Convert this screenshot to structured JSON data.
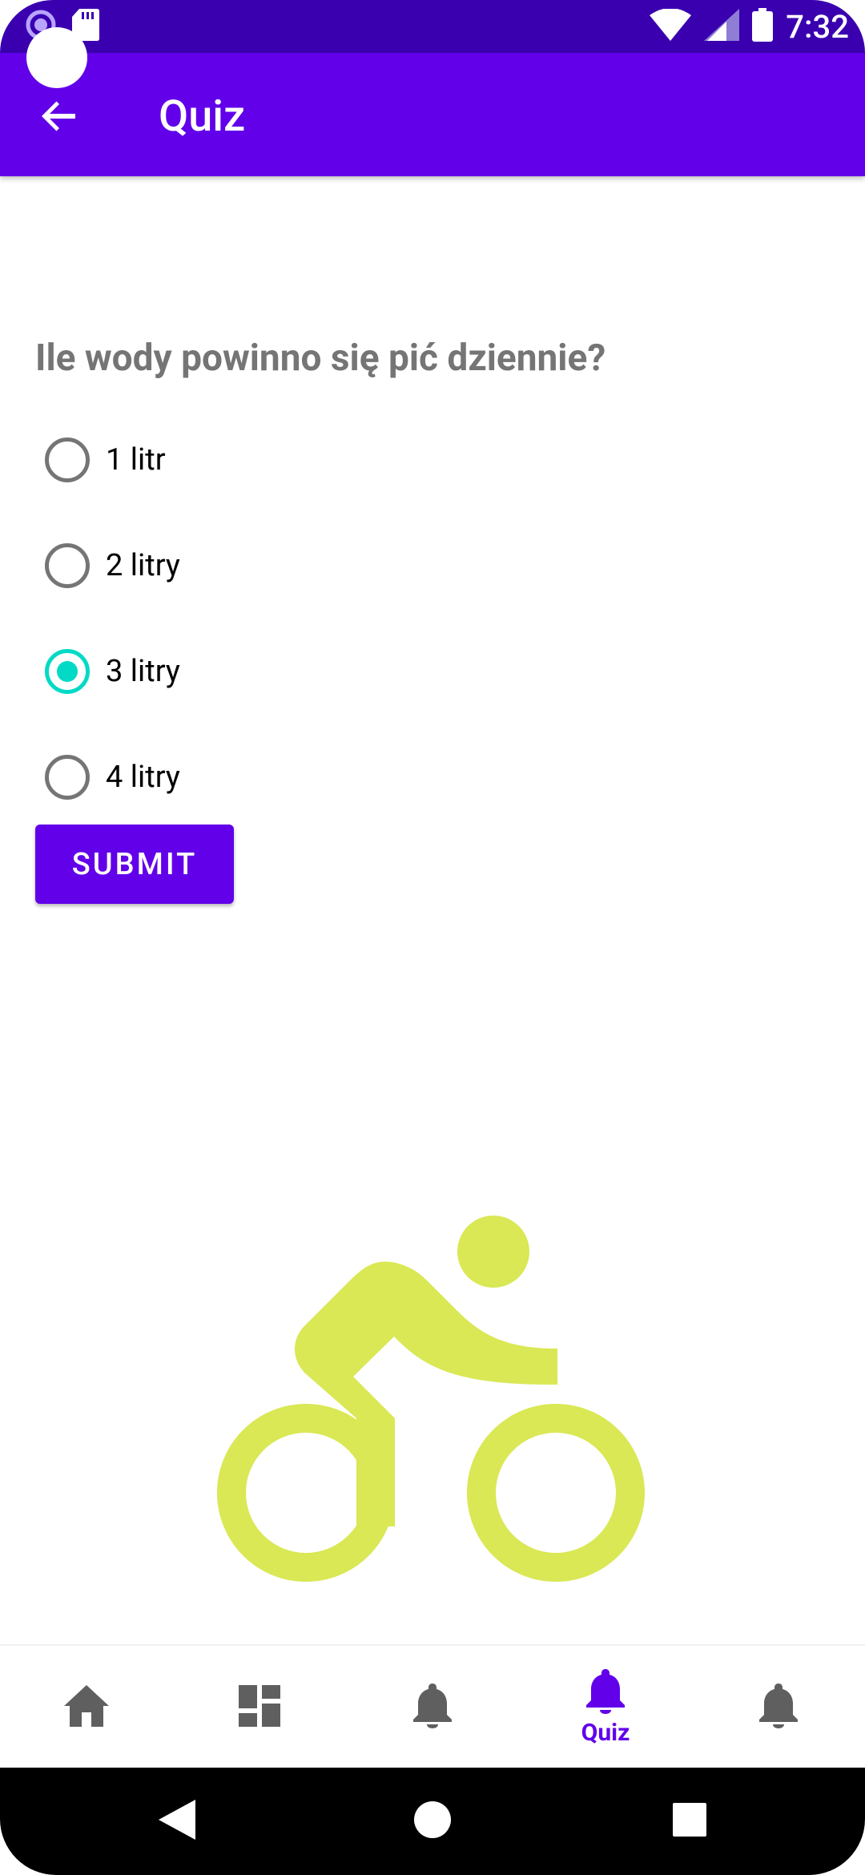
{
  "status_bar": {
    "time": "7:32"
  },
  "app_bar": {
    "title": "Quiz"
  },
  "quiz": {
    "question": "Ile wody powinno się pić dziennie?",
    "options": [
      {
        "label": "1 litr",
        "selected": false
      },
      {
        "label": "2 litry",
        "selected": false
      },
      {
        "label": "3 litry",
        "selected": true
      },
      {
        "label": "4 litry",
        "selected": false
      }
    ],
    "submit_label": "SUBMIT"
  },
  "illustration": {
    "icon": "bike-icon",
    "color": "#d9e854"
  },
  "bottom_nav": {
    "items": [
      {
        "icon": "home-icon",
        "label": ""
      },
      {
        "icon": "dashboard-icon",
        "label": ""
      },
      {
        "icon": "bell-icon",
        "label": ""
      },
      {
        "icon": "bell-icon",
        "label": "Quiz",
        "active": true
      },
      {
        "icon": "bell-icon",
        "label": ""
      }
    ]
  },
  "colors": {
    "primary": "#6200ea",
    "status_bar": "#3a00b0",
    "accent": "#03dac5",
    "inactive_icon": "#5f5f5f"
  }
}
